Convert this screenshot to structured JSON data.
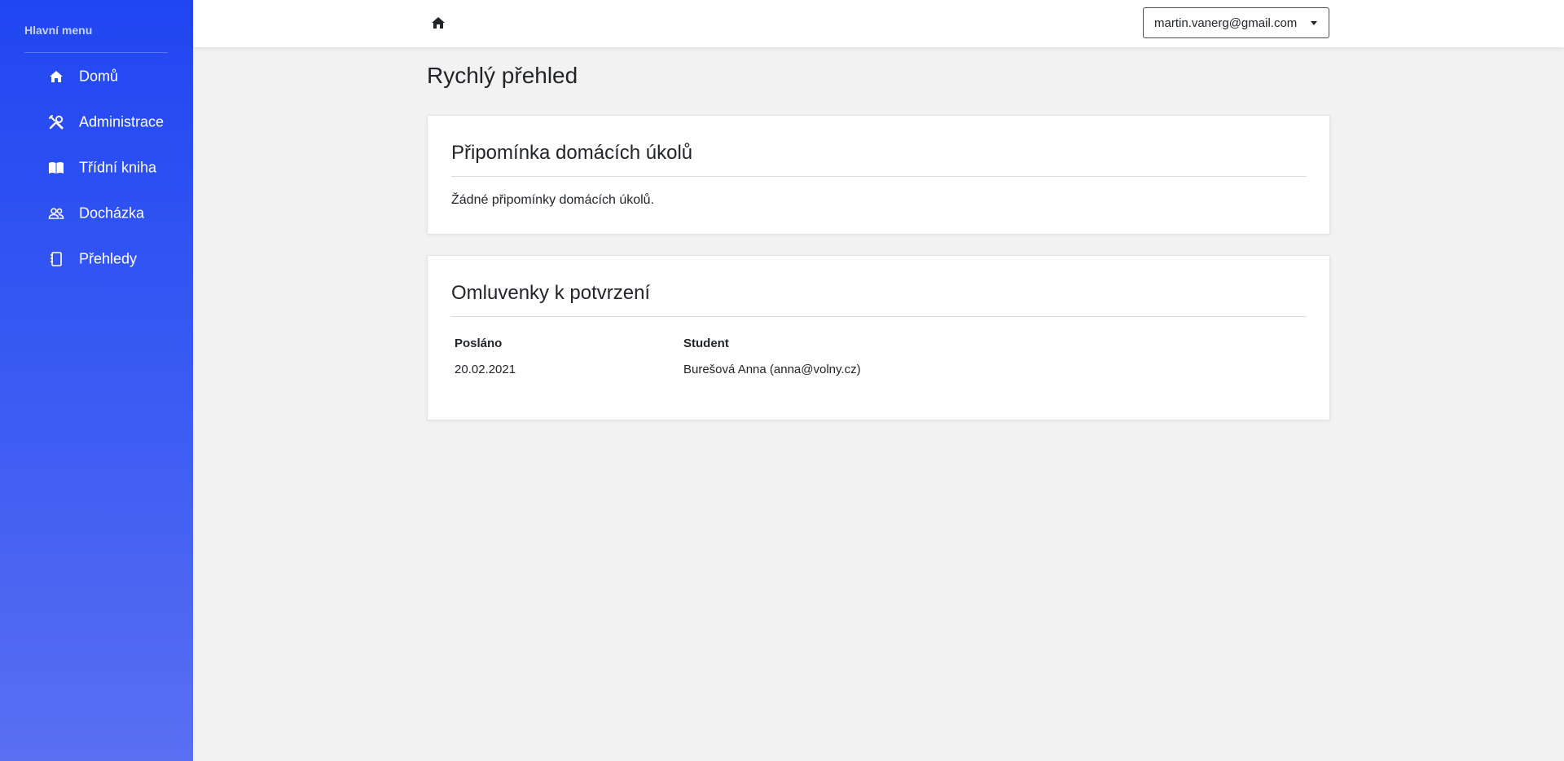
{
  "sidebar": {
    "heading": "Hlavní menu",
    "items": [
      {
        "label": "Domů",
        "icon": "home-icon"
      },
      {
        "label": "Administrace",
        "icon": "tools-icon"
      },
      {
        "label": "Třídní kniha",
        "icon": "book-icon"
      },
      {
        "label": "Docházka",
        "icon": "people-icon"
      },
      {
        "label": "Přehledy",
        "icon": "journal-icon"
      }
    ],
    "gradient_top": "#2046f2",
    "gradient_bottom": "#5a6ff2"
  },
  "topbar": {
    "home_icon": "home-icon",
    "user_email": "martin.vanerg@gmail.com"
  },
  "main": {
    "page_title": "Rychlý přehled",
    "homework_card": {
      "title": "Připomínka domácích úkolů",
      "empty_text": "Žádné připomínky domácích úkolů."
    },
    "excuses_card": {
      "title": "Omluvenky k potvrzení",
      "columns": [
        "Posláno",
        "Student"
      ],
      "rows": [
        [
          "20.02.2021",
          "Burešová Anna (anna@volny.cz)"
        ]
      ]
    }
  }
}
